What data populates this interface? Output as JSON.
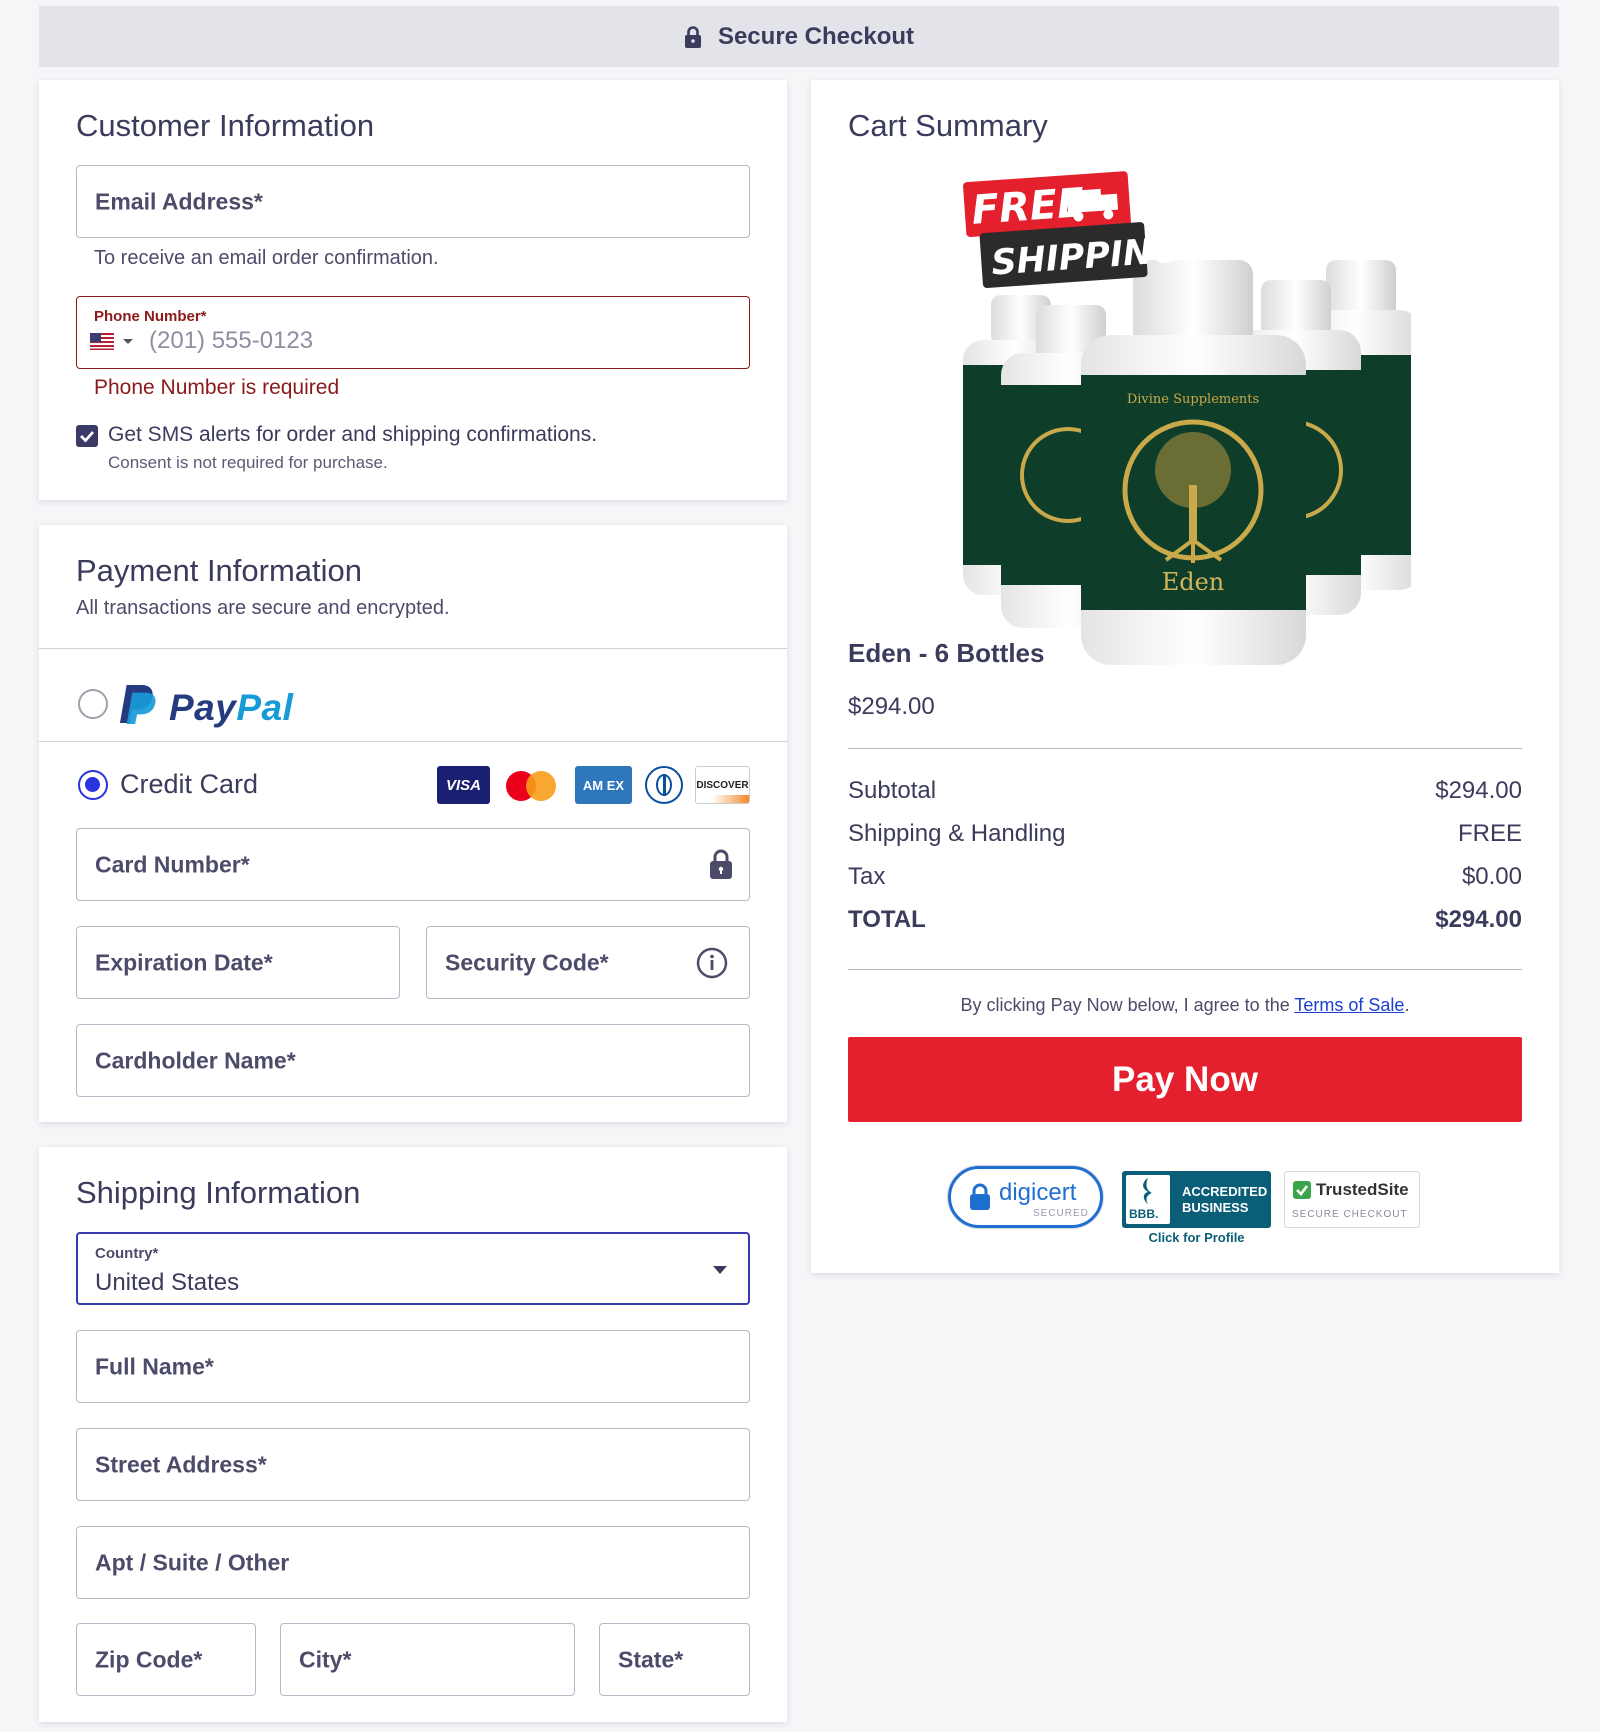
{
  "header": {
    "title": "Secure Checkout",
    "icon": "lock-icon"
  },
  "customer": {
    "title": "Customer Information",
    "email_label": "Email Address*",
    "email_help": "To receive an email order confirmation.",
    "phone_label": "Phone Number*",
    "phone_placeholder": "(201) 555-0123",
    "phone_error": "Phone Number is required",
    "sms_label": "Get SMS alerts for order and shipping confirmations.",
    "sms_checked": true,
    "sms_note": "Consent is not required for purchase."
  },
  "payment": {
    "title": "Payment Information",
    "subtitle": "All transactions are secure and encrypted.",
    "paypal_text_pay": "Pay",
    "paypal_text_pal": "Pal",
    "credit_card_label": "Credit Card",
    "card_brands": [
      "VISA",
      "mastercard",
      "AMEX",
      "diners",
      "DISCOVER"
    ],
    "visa_text": "VISA",
    "amex_text": "AM EX",
    "discover_text": "DISCOVER",
    "card_number_label": "Card Number*",
    "expiration_label": "Expiration Date*",
    "security_code_label": "Security Code*",
    "cardholder_label": "Cardholder Name*"
  },
  "shipping": {
    "title": "Shipping Information",
    "country_label": "Country*",
    "country_value": "United States",
    "full_name_label": "Full Name*",
    "street_label": "Street Address*",
    "apt_label": "Apt / Suite / Other",
    "zip_label": "Zip Code*",
    "city_label": "City*",
    "state_label": "State*"
  },
  "cart": {
    "title": "Cart Summary",
    "badge_free": "FREE",
    "badge_shipping": "SHIPPING",
    "bottle_brand": "Divine Supplements",
    "bottle_name": "Eden",
    "product_name": "Eden - 6 Bottles",
    "product_price": "$294.00",
    "subtotal_label": "Subtotal",
    "subtotal_value": "$294.00",
    "shipping_label": "Shipping & Handling",
    "shipping_value": "FREE",
    "tax_label": "Tax",
    "tax_value": "$0.00",
    "total_label": "TOTAL",
    "total_value": "$294.00",
    "terms_prefix": "By clicking Pay Now below, I agree to the ",
    "terms_link": "Terms of Sale",
    "terms_suffix": ".",
    "pay_button": "Pay Now"
  },
  "trust": {
    "digicert": "digicert",
    "digicert_sub": "SECURED",
    "bbb_line1": "ACCREDITED",
    "bbb_line2": "BUSINESS",
    "bbb_mark": "BBB.",
    "bbb_link": "Click for Profile",
    "trustedsite": "TrustedSite",
    "trustedsite_sub": "SECURE CHECKOUT"
  },
  "colors": {
    "accent_blue": "#2a33e0",
    "error_red": "#8b1a1a",
    "pay_button": "#e5202e",
    "field_border": "#b8b8c6",
    "focus_border": "#3a3ab0"
  }
}
